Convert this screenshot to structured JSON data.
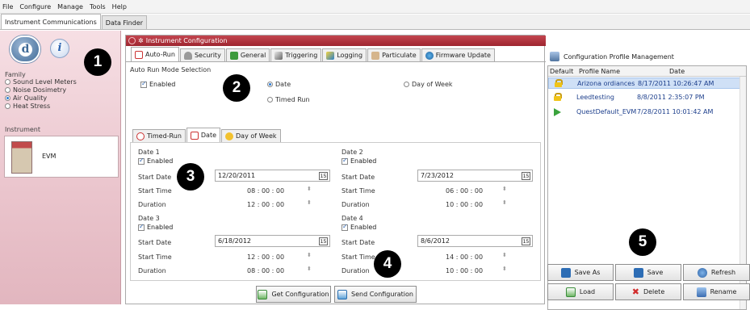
{
  "menu": [
    "File",
    "Configure",
    "Manage",
    "Tools",
    "Help"
  ],
  "top_tabs": [
    "Instrument Communications",
    "Data Finder"
  ],
  "left": {
    "family_label": "Family",
    "families": [
      {
        "label": "Sound Level Meters",
        "selected": false
      },
      {
        "label": "Noise Dosimetry",
        "selected": false
      },
      {
        "label": "Air Quality",
        "selected": true
      },
      {
        "label": "Heat Stress",
        "selected": false
      }
    ],
    "instrument_label": "Instrument",
    "instrument_name": "EVM"
  },
  "config": {
    "title": "Instrument Configuration",
    "tabs": [
      "Auto-Run",
      "Security",
      "General",
      "Triggering",
      "Logging",
      "Particulate",
      "Firmware Update"
    ],
    "mode_group": "Auto Run Mode Selection",
    "enabled_label": "Enabled",
    "mode_options": {
      "date": "Date",
      "day_of_week": "Day of Week",
      "timed_run": "Timed Run"
    },
    "selected_mode": "Date",
    "inner_tabs": [
      "Timed-Run",
      "Date",
      "Day of Week"
    ],
    "field_labels": {
      "start_date": "Start Date",
      "start_time": "Start Time",
      "duration": "Duration",
      "enabled": "Enabled"
    },
    "dates": [
      {
        "title": "Date 1",
        "enabled": true,
        "start_date": "12/20/2011",
        "start_time": "08 : 00 : 00",
        "duration": "12 : 00 : 00"
      },
      {
        "title": "Date 2",
        "enabled": true,
        "start_date": "7/23/2012",
        "start_time": "06 : 00 : 00",
        "duration": "10 : 00 : 00"
      },
      {
        "title": "Date 3",
        "enabled": true,
        "start_date": "6/18/2012",
        "start_time": "12 : 00 : 00",
        "duration": "08 : 00 : 00"
      },
      {
        "title": "Date 4",
        "enabled": true,
        "start_date": "8/6/2012",
        "start_time": "14 : 00 : 00",
        "duration": "10 : 00 : 00"
      }
    ],
    "get_button": "Get Configuration",
    "send_button": "Send Configuration"
  },
  "profiles": {
    "title": "Configuration Profile Management",
    "columns": [
      "Default",
      "Profile Name",
      "Date"
    ],
    "rows": [
      {
        "icon": "lock-icon",
        "name": "Arizona ordiances",
        "date": "8/17/2011 10:26:47 AM",
        "selected": true
      },
      {
        "icon": "lock-icon",
        "name": "Leedtesting",
        "date": "8/8/2011 2:35:07 PM",
        "selected": false
      },
      {
        "icon": "arrow-icon",
        "name": "QuestDefault_EVM",
        "date": "7/28/2011 10:01:42 AM",
        "selected": false
      }
    ],
    "buttons": [
      "Save As",
      "Save",
      "Refresh",
      "Load",
      "Delete",
      "Rename"
    ]
  },
  "callouts": [
    "1",
    "2",
    "3",
    "4",
    "5"
  ]
}
